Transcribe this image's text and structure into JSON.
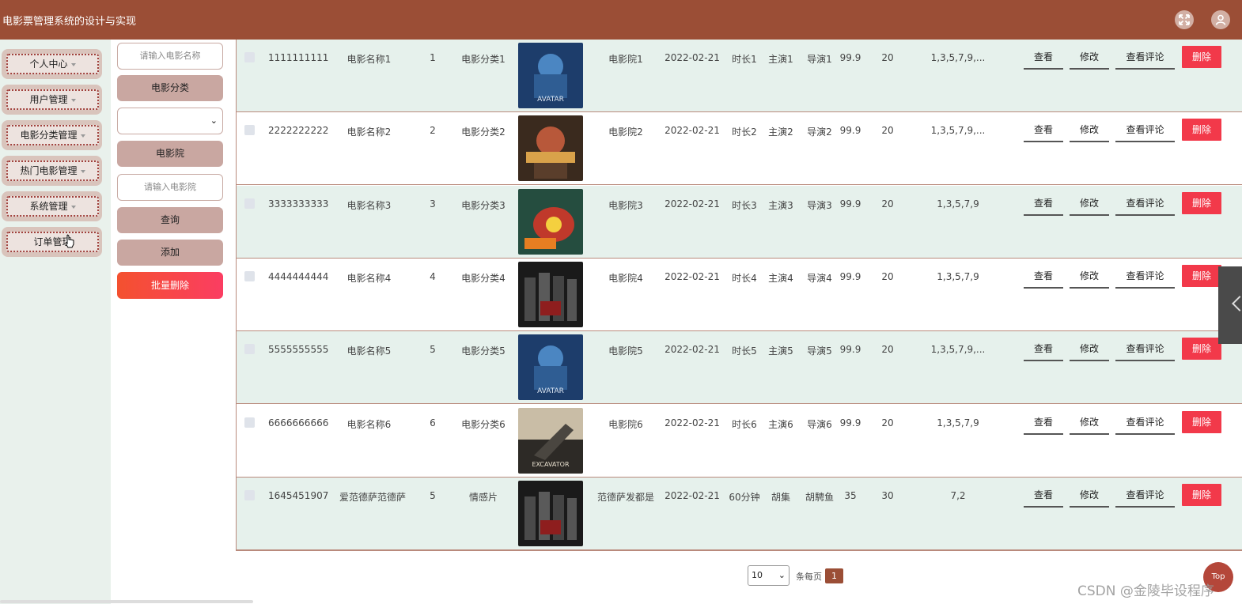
{
  "app": {
    "title": "电影票管理系统的设计与实现"
  },
  "header_icons": [
    "fullscreen-icon",
    "user-icon"
  ],
  "sidebar": {
    "items": [
      {
        "label": "个人中心"
      },
      {
        "label": "用户管理"
      },
      {
        "label": "电影分类管理"
      },
      {
        "label": "热门电影管理"
      },
      {
        "label": "系统管理"
      },
      {
        "label": "订单管理"
      }
    ]
  },
  "filters": {
    "movie_name_placeholder": "请输入电影名称",
    "category_label": "电影分类",
    "category_value": "",
    "cinema_label": "电影院",
    "cinema_placeholder": "请输入电影院",
    "query_label": "查询",
    "add_label": "添加",
    "batch_delete_label": "批量删除"
  },
  "actions": {
    "view": "查看",
    "edit": "修改",
    "view_comments": "查看评论",
    "delete": "删除"
  },
  "rows": [
    {
      "id": "1111111111",
      "name": "电影名称1",
      "num": "1",
      "category": "电影分类1",
      "cinema": "电影院1",
      "date": "2022-02-21",
      "duration": "时长1",
      "lead": "主演1",
      "director": "导演1",
      "price": "99.9",
      "seats": "20",
      "schedule": "1,3,5,7,9,...",
      "poster": "poster-avatar"
    },
    {
      "id": "2222222222",
      "name": "电影名称2",
      "num": "2",
      "category": "电影分类2",
      "cinema": "电影院2",
      "date": "2022-02-21",
      "duration": "时长2",
      "lead": "主演2",
      "director": "导演2",
      "price": "99.9",
      "seats": "20",
      "schedule": "1,3,5,7,9,...",
      "poster": "poster-avengers"
    },
    {
      "id": "3333333333",
      "name": "电影名称3",
      "num": "3",
      "category": "电影分类3",
      "cinema": "电影院3",
      "date": "2022-02-21",
      "duration": "时长3",
      "lead": "主演3",
      "director": "导演3",
      "price": "99.9",
      "seats": "20",
      "schedule": "1,3,5,7,9",
      "poster": "poster-dragon"
    },
    {
      "id": "4444444444",
      "name": "电影名称4",
      "num": "4",
      "category": "电影分类4",
      "cinema": "电影院4",
      "date": "2022-02-21",
      "duration": "时长4",
      "lead": "主演4",
      "director": "导演4",
      "price": "99.9",
      "seats": "20",
      "schedule": "1,3,5,7,9",
      "poster": "poster-group"
    },
    {
      "id": "5555555555",
      "name": "电影名称5",
      "num": "5",
      "category": "电影分类5",
      "cinema": "电影院5",
      "date": "2022-02-21",
      "duration": "时长5",
      "lead": "主演5",
      "director": "导演5",
      "price": "99.9",
      "seats": "20",
      "schedule": "1,3,5,7,9,...",
      "poster": "poster-avatar"
    },
    {
      "id": "6666666666",
      "name": "电影名称6",
      "num": "6",
      "category": "电影分类6",
      "cinema": "电影院6",
      "date": "2022-02-21",
      "duration": "时长6",
      "lead": "主演6",
      "director": "导演6",
      "price": "99.9",
      "seats": "20",
      "schedule": "1,3,5,7,9",
      "poster": "poster-excavator"
    },
    {
      "id": "1645451907",
      "name": "爱范德萨范德萨",
      "num": "5",
      "category": "情感片",
      "cinema": "范德萨发都是",
      "date": "2022-02-21",
      "duration": "60分钟",
      "lead": "胡集",
      "director": "胡騁鱼",
      "price": "35",
      "seats": "30",
      "schedule": "7,2",
      "poster": "poster-group"
    }
  ],
  "pagination": {
    "page_size": "10",
    "per_page_text": "条每页",
    "current_page": "1"
  },
  "top_button": "Top",
  "watermark": "CSDN @金陵毕设程序"
}
